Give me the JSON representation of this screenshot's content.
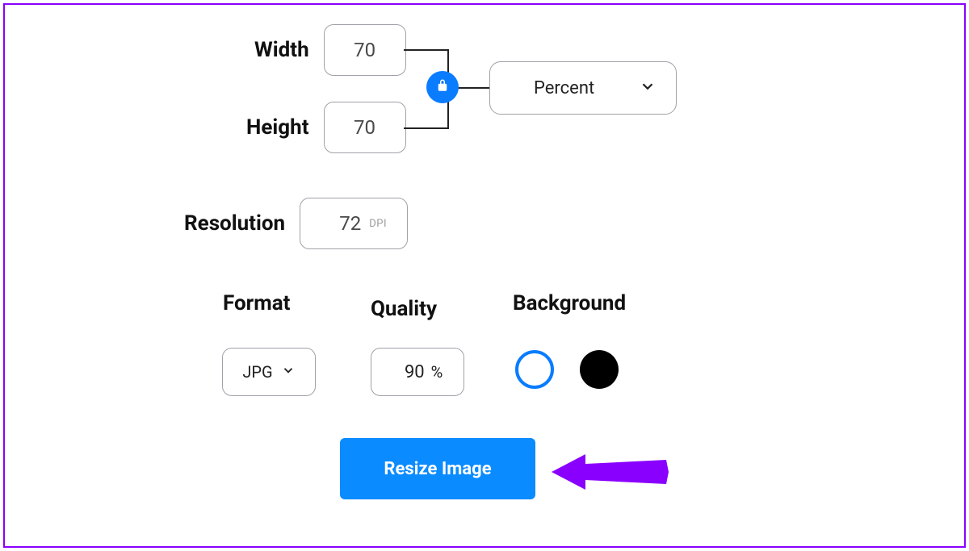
{
  "labels": {
    "width": "Width",
    "height": "Height",
    "resolution": "Resolution",
    "format": "Format",
    "quality": "Quality",
    "background": "Background"
  },
  "values": {
    "width": "70",
    "height": "70",
    "resolution": "72",
    "quality": "90"
  },
  "units": {
    "dpi": "DPI",
    "percent_sign": "%"
  },
  "dropdowns": {
    "unit_selected": "Percent",
    "format_selected": "JPG"
  },
  "background": {
    "selected": "white"
  },
  "button": {
    "resize": "Resize Image"
  },
  "colors": {
    "accent_blue": "#0a7cff",
    "button_blue": "#0a8bff",
    "frame_purple": "#8a00ff"
  }
}
